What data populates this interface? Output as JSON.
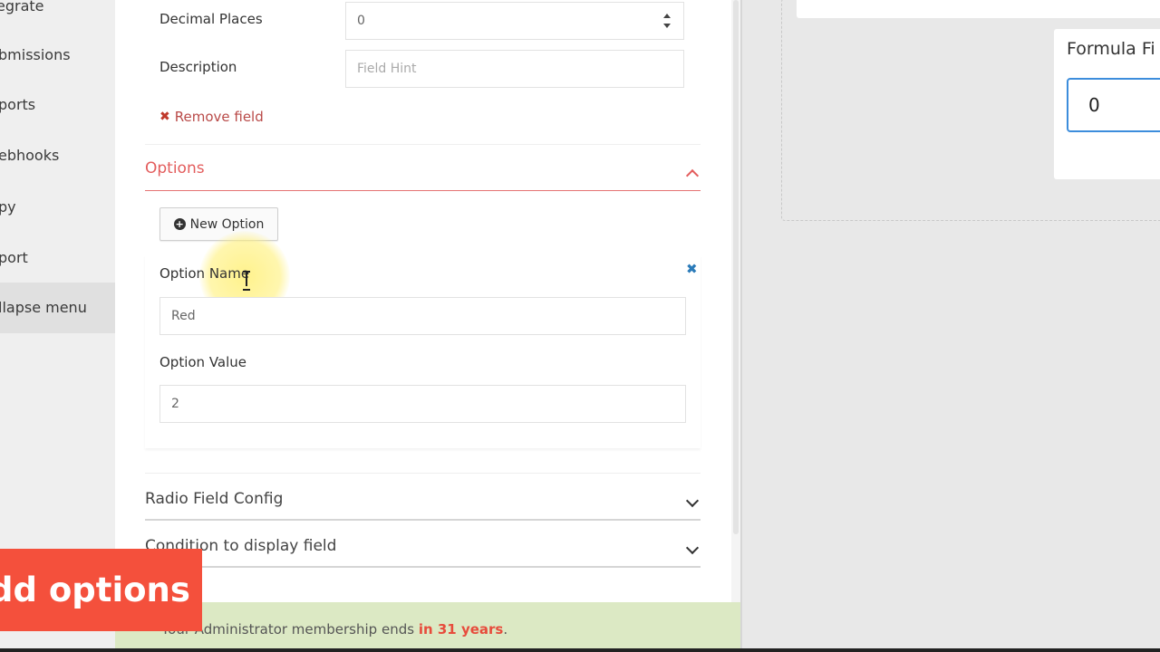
{
  "sidebar": {
    "items": [
      {
        "label": "egrate"
      },
      {
        "label": "bmissions"
      },
      {
        "label": "ports"
      },
      {
        "label": "ebhooks"
      },
      {
        "label": "py"
      },
      {
        "label": "port"
      },
      {
        "label": "llapse menu"
      }
    ]
  },
  "field_settings": {
    "decimal_places_label": "Decimal Places",
    "decimal_places_value": "0",
    "description_label": "Description",
    "description_placeholder": "Field Hint",
    "remove_field": "Remove field"
  },
  "options_section": {
    "title": "Options",
    "new_option_button": "New Option",
    "option_name_label": "Option Name",
    "option_name_value": "Red",
    "option_value_label": "Option Value",
    "option_value_value": "2"
  },
  "accordions": {
    "radio_config": "Radio Field Config",
    "condition": "Condition to display field"
  },
  "footer": {
    "text_prefix": "Your Administrator membership ends ",
    "text_highlight": "in 31 years",
    "text_suffix": "."
  },
  "caption": {
    "text": "dd options"
  },
  "preview": {
    "formula_label": "Formula Fi",
    "formula_value": "0"
  },
  "colors": {
    "accent_red": "#e35d5d",
    "caption_bg": "#f4503c",
    "focus_blue": "#3c8ddc",
    "footer_bg": "#dce9c4"
  }
}
